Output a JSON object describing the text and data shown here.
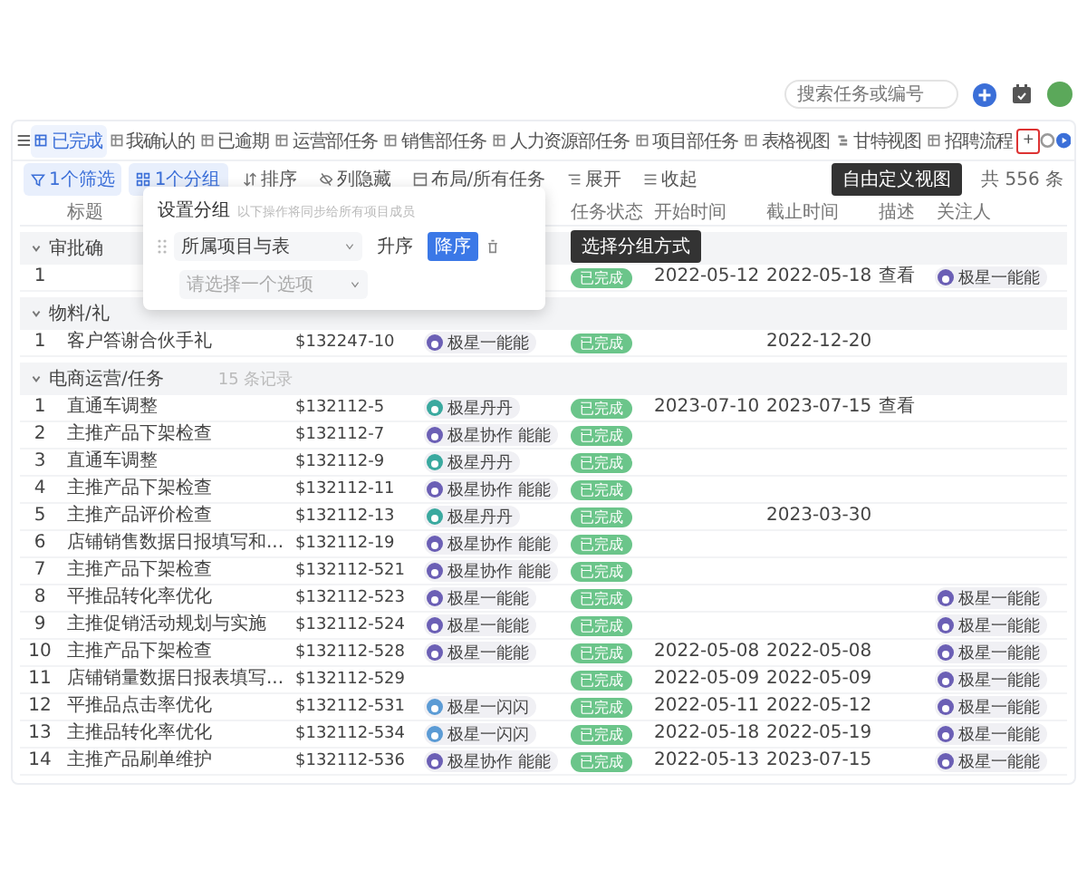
{
  "header": {
    "search": {
      "placeholder": "搜索任务或编号"
    }
  },
  "tabs": [
    {
      "label": "已完成",
      "selected": true,
      "kind": "table"
    },
    {
      "label": "我确认的",
      "selected": false,
      "kind": "table"
    },
    {
      "label": "已逾期",
      "selected": false,
      "kind": "table"
    },
    {
      "label": "运营部任务",
      "selected": false,
      "kind": "table"
    },
    {
      "label": "销售部任务",
      "selected": false,
      "kind": "table"
    },
    {
      "label": "人力资源部任务",
      "selected": false,
      "kind": "table"
    },
    {
      "label": "项目部任务",
      "selected": false,
      "kind": "table"
    },
    {
      "label": "表格视图",
      "selected": false,
      "kind": "table"
    },
    {
      "label": "甘特视图",
      "selected": false,
      "kind": "gantt"
    },
    {
      "label": "招聘流程",
      "selected": false,
      "kind": "table"
    }
  ],
  "add_view": {
    "label": "+",
    "tooltip": "自由定义视图"
  },
  "toolbar": {
    "items": [
      {
        "label": "1个筛选",
        "active": true,
        "kind": "filter"
      },
      {
        "label": "1个分组",
        "active": true,
        "kind": "group"
      },
      {
        "label": "排序",
        "active": false,
        "kind": "sort"
      },
      {
        "label": "列隐藏",
        "active": false,
        "kind": "hide"
      },
      {
        "label": "布局/所有任务",
        "active": false,
        "kind": "layout"
      },
      {
        "label": "展开",
        "active": false,
        "kind": "expand"
      },
      {
        "label": "收起",
        "active": false,
        "kind": "collapse"
      }
    ],
    "total": "共 556 条"
  },
  "table": {
    "columns": [
      {
        "label": "标题"
      },
      {
        "label": "任务状态"
      },
      {
        "label": "开始时间"
      },
      {
        "label": "截止时间"
      },
      {
        "label": "描述"
      },
      {
        "label": "关注人"
      }
    ],
    "groups": [
      {
        "label": "审批确",
        "expanded": true,
        "rows": [
          {
            "number": "1",
            "status": "已完成",
            "start": "2022-05-12",
            "end": "2022-05-18",
            "desc": "查看",
            "follower": {
              "name": "极星一能能",
              "color": "#6b5fb5"
            }
          }
        ]
      },
      {
        "label": "物料/礼",
        "expanded": true,
        "rows": [
          {
            "number": "1",
            "title": "客户答谢合伙手礼",
            "id": "$132247-10",
            "person": {
              "name": "极星一能能",
              "color": "#6b5fb5"
            },
            "status": "已完成",
            "end": "2022-12-20"
          }
        ]
      },
      {
        "label": "电商运营/任务",
        "count": "15 条记录",
        "expanded": true,
        "rows": [
          {
            "number": "1",
            "title": "直通车调整",
            "id": "$132112-5",
            "person": {
              "name": "极星丹丹",
              "color": "#3aa99f"
            },
            "status": "已完成",
            "start": "2023-07-10",
            "end": "2023-07-15",
            "desc": "查看"
          },
          {
            "number": "2",
            "title": "主推产品下架检查",
            "id": "$132112-7",
            "person": {
              "name": "极星协作 能能",
              "color": "#6b5fb5"
            },
            "status": "已完成"
          },
          {
            "number": "3",
            "title": "直通车调整",
            "id": "$132112-9",
            "person": {
              "name": "极星丹丹",
              "color": "#3aa99f"
            },
            "status": "已完成"
          },
          {
            "number": "4",
            "title": "主推产品下架检查",
            "id": "$132112-11",
            "person": {
              "name": "极星协作 能能",
              "color": "#6b5fb5"
            },
            "status": "已完成"
          },
          {
            "number": "5",
            "title": "主推产品评价检查",
            "id": "$132112-13",
            "person": {
              "name": "极星丹丹",
              "color": "#3aa99f"
            },
            "status": "已完成",
            "end": "2023-03-30"
          },
          {
            "number": "6",
            "title": "店铺销售数据日报填写和...",
            "id": "$132112-19",
            "person": {
              "name": "极星协作 能能",
              "color": "#6b5fb5"
            },
            "status": "已完成"
          },
          {
            "number": "7",
            "title": "主推产品下架检查",
            "id": "$132112-521",
            "person": {
              "name": "极星协作 能能",
              "color": "#6b5fb5"
            },
            "status": "已完成"
          },
          {
            "number": "8",
            "title": "平推品转化率优化",
            "id": "$132112-523",
            "person": {
              "name": "极星一能能",
              "color": "#6b5fb5"
            },
            "status": "已完成",
            "follower": {
              "name": "极星一能能",
              "color": "#6b5fb5"
            }
          },
          {
            "number": "9",
            "title": "主推促销活动规划与实施",
            "id": "$132112-524",
            "person": {
              "name": "极星一能能",
              "color": "#6b5fb5"
            },
            "status": "已完成",
            "follower": {
              "name": "极星一能能",
              "color": "#6b5fb5"
            }
          },
          {
            "number": "10",
            "title": "主推产品下架检查",
            "id": "$132112-528",
            "person": {
              "name": "极星一能能",
              "color": "#6b5fb5"
            },
            "status": "已完成",
            "start": "2022-05-08",
            "end": "2022-05-08",
            "follower": {
              "name": "极星一能能",
              "color": "#6b5fb5"
            }
          },
          {
            "number": "11",
            "title": "店铺销量数据日报表填写...",
            "id": "$132112-529",
            "status": "已完成",
            "start": "2022-05-09",
            "end": "2022-05-09",
            "follower": {
              "name": "极星一能能",
              "color": "#6b5fb5"
            }
          },
          {
            "number": "12",
            "title": "平推品点击率优化",
            "id": "$132112-531",
            "person": {
              "name": "极星一闪闪",
              "color": "#5b9bd5"
            },
            "status": "已完成",
            "start": "2022-05-11",
            "end": "2022-05-12",
            "follower": {
              "name": "极星一能能",
              "color": "#6b5fb5"
            }
          },
          {
            "number": "13",
            "title": "主推品转化率优化",
            "id": "$132112-534",
            "person": {
              "name": "极星一闪闪",
              "color": "#5b9bd5"
            },
            "status": "已完成",
            "start": "2022-05-18",
            "end": "2022-05-19",
            "follower": {
              "name": "极星一能能",
              "color": "#6b5fb5"
            }
          },
          {
            "number": "14",
            "title": "主推产品刷单维护",
            "id": "$132112-536",
            "person": {
              "name": "极星协作 能能",
              "color": "#6b5fb5"
            },
            "status": "已完成",
            "start": "2022-05-13",
            "end": "2023-07-15",
            "follower": {
              "name": "极星一能能",
              "color": "#6b5fb5"
            }
          }
        ]
      }
    ]
  },
  "group_popup": {
    "title": "设置分组",
    "hint": "以下操作将同步给所有项目成员",
    "field": "所属项目与表",
    "order": [
      {
        "label": "升序",
        "selected": false
      },
      {
        "label": "降序",
        "selected": true
      }
    ],
    "placeholder": "请选择一个选项",
    "tooltip": "选择分组方式"
  }
}
